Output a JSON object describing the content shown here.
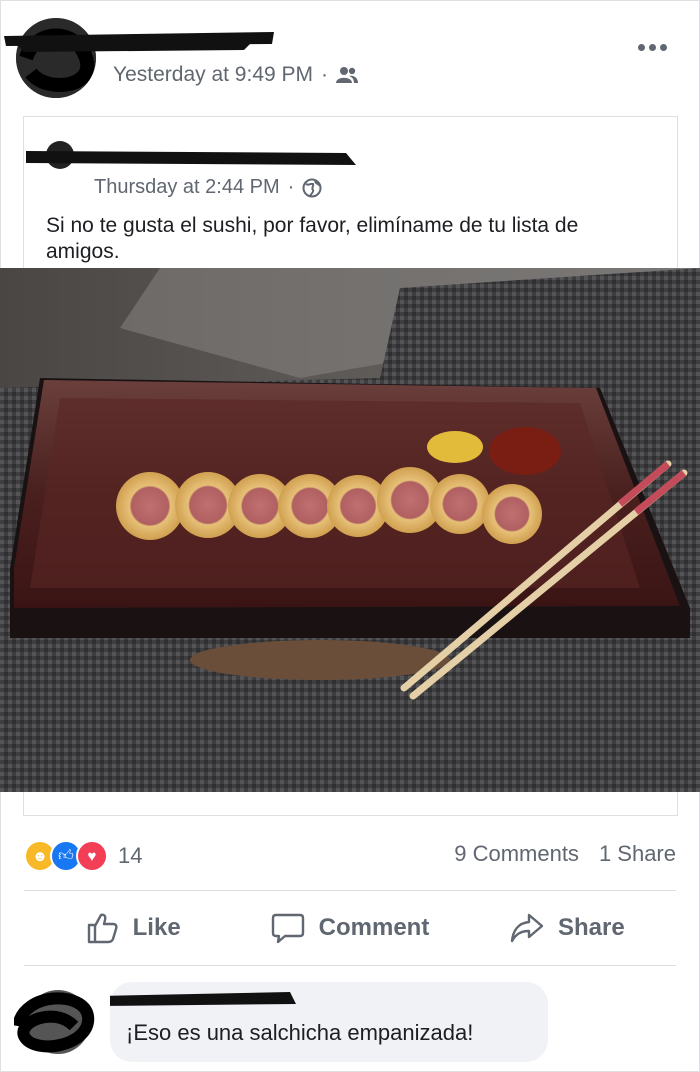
{
  "post": {
    "timestamp": "Yesterday at 9:49 PM",
    "separator": "·",
    "audience_icon": "friends-icon",
    "more_icon": "more-options-icon"
  },
  "shared_post": {
    "timestamp": "Thursday at 2:44 PM",
    "separator": "·",
    "audience_icon": "globe-icon",
    "text": "Si no te gusta el sushi, por favor, elimíname de tu lista de amigos."
  },
  "stats": {
    "reaction_icons": [
      "haha-icon",
      "like-icon",
      "love-icon"
    ],
    "reaction_count": "14",
    "comments": "9 Comments",
    "shares": "1 Share"
  },
  "actions": {
    "like_label": "Like",
    "comment_label": "Comment",
    "share_label": "Share"
  },
  "comment": {
    "text": "¡Eso es una salchicha empanizada!"
  },
  "colors": {
    "meta_text": "#606770",
    "divider": "#dadde1",
    "bubble_bg": "#f0f2f5",
    "like_blue": "#1877f2",
    "love_red": "#f33e58",
    "haha_yellow": "#f7b928"
  }
}
